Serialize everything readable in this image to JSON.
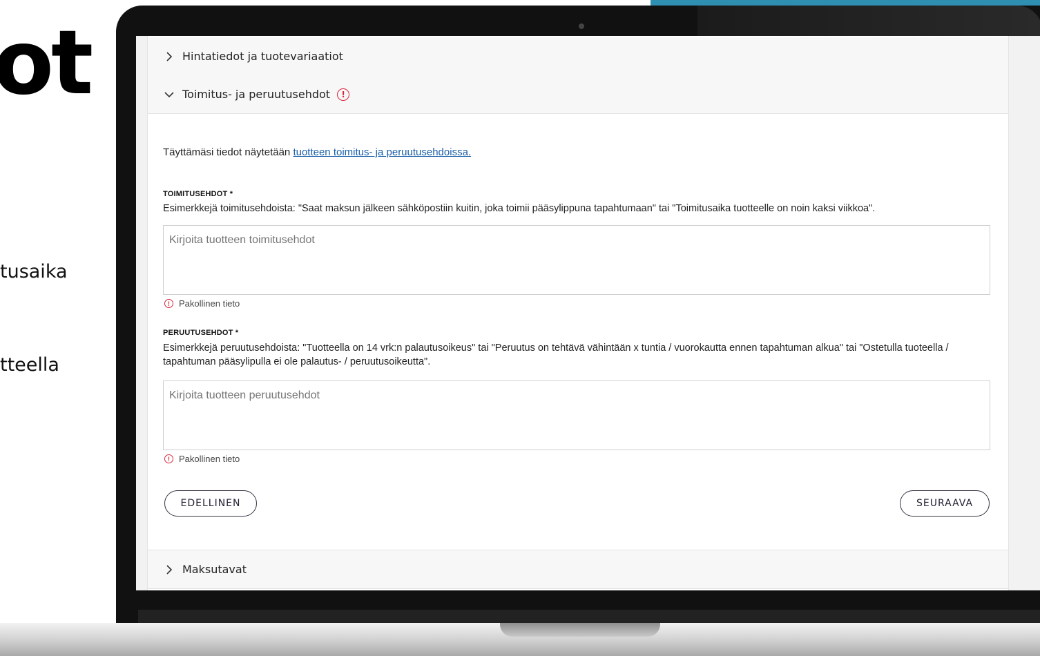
{
  "background": {
    "heading_fragment": "ot",
    "text_fragment_1": "tusaika",
    "text_fragment_2": "tteella"
  },
  "accordion": {
    "section_1": {
      "title": "Hintatiedot ja tuotevariaatiot",
      "state": "collapsed"
    },
    "section_2": {
      "title": "Toimitus- ja peruutusehdot",
      "state": "expanded",
      "warning_icon": "!"
    },
    "section_3": {
      "title": "Maksutavat",
      "state": "collapsed"
    }
  },
  "form": {
    "intro_text": "Täyttämäsi tiedot näytetään ",
    "intro_link": "tuotteen toimitus- ja peruutusehdoissa.",
    "delivery": {
      "label": "TOIMITUSEHDOT *",
      "description": "Esimerkkejä toimitusehdoista: \"Saat maksun jälkeen sähköpostiin kuitin, joka toimii pääsylippuna tapahtumaan\" tai \"Toimitusaika tuotteelle on noin kaksi viikkoa\".",
      "placeholder": "Kirjoita tuotteen toimitusehdot",
      "error": "Pakollinen tieto"
    },
    "cancellation": {
      "label": "PERUUTUSEHDOT *",
      "description": "Esimerkkejä peruutusehdoista: \"Tuotteella on 14 vrk:n palautusoikeus\" tai \"Peruutus on tehtävä vähintään x tuntia / vuorokautta ennen tapahtuman alkua\" tai \"Ostetulla tuoteella / tapahtuman pääsylipulla ei ole palautus- / peruutusoikeutta\".",
      "placeholder": "Kirjoita tuotteen peruutusehdot",
      "error": "Pakollinen tieto"
    },
    "buttons": {
      "previous": "EDELLINEN",
      "next": "SEURAAVA"
    }
  },
  "colors": {
    "accent_link": "#1a5fa8",
    "error_red": "#d7263d",
    "teal_strip": "#2e8fb0"
  }
}
